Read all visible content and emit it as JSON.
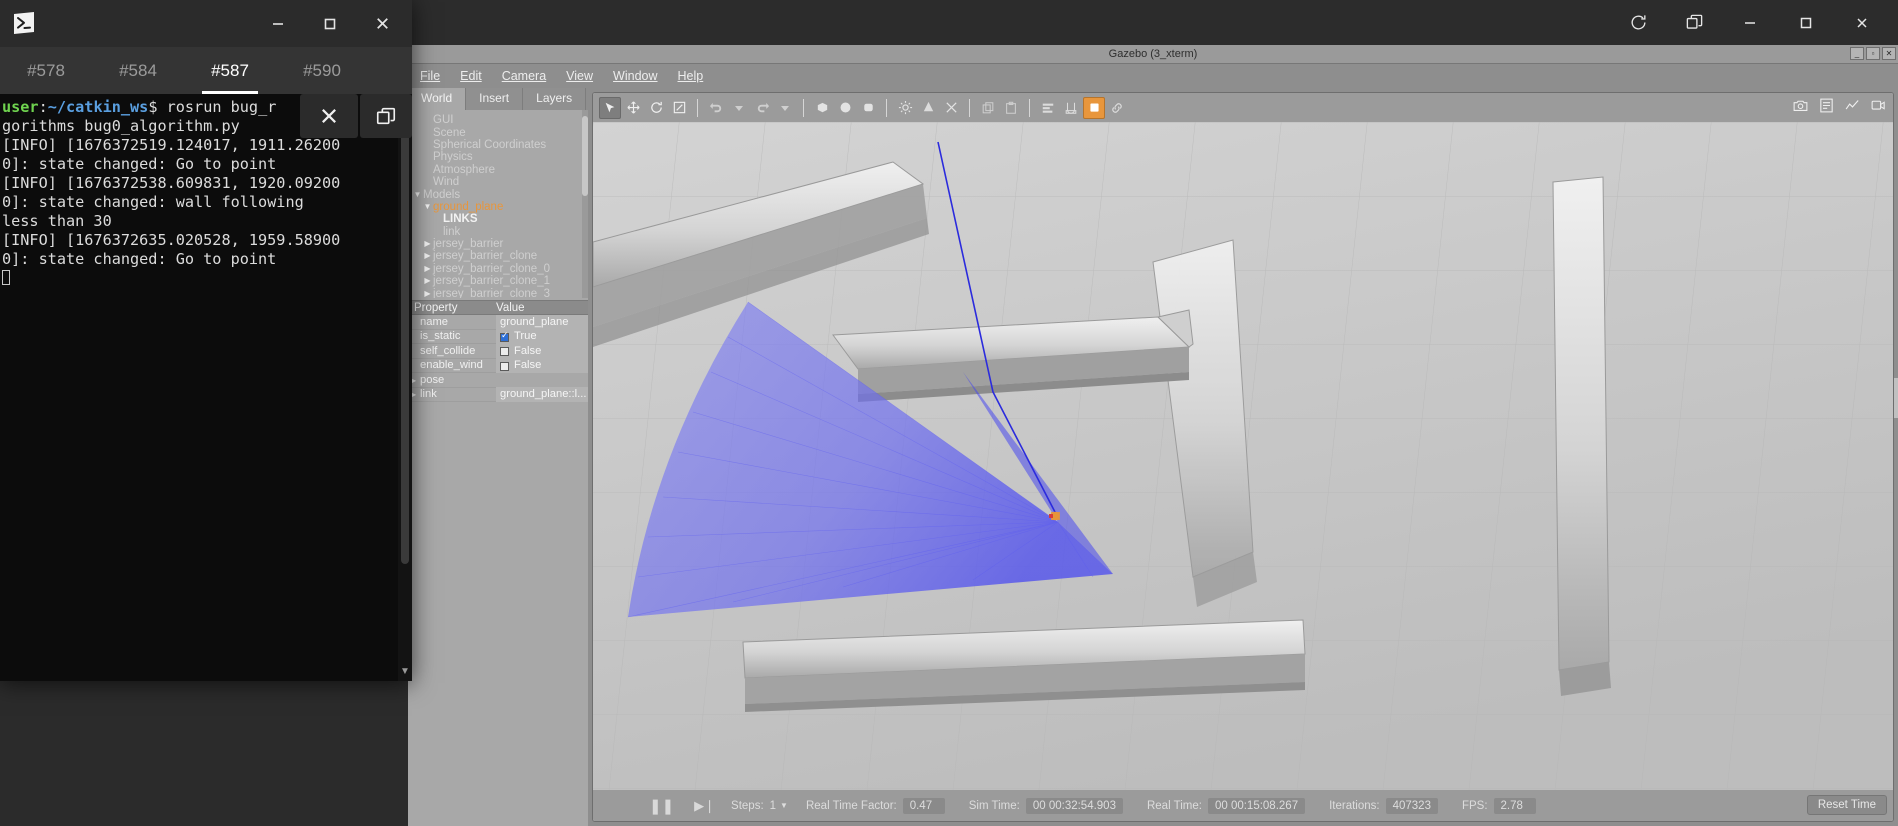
{
  "host_window": {
    "title_buttons": [
      {
        "name": "refresh",
        "glyph": "⟳"
      },
      {
        "name": "duplicate",
        "glyph": "❐"
      },
      {
        "name": "minimize",
        "glyph": "—"
      },
      {
        "name": "maximize",
        "glyph": "▢"
      },
      {
        "name": "close",
        "glyph": "✕"
      }
    ]
  },
  "gazebo": {
    "window_title": "Gazebo (3_xterm)",
    "window_buttons": [
      "_",
      "▫",
      "✕"
    ],
    "menu": [
      "File",
      "Edit",
      "Camera",
      "View",
      "Window",
      "Help"
    ],
    "panel_tabs": [
      "World",
      "Insert",
      "Layers"
    ],
    "tree": [
      {
        "label": "GUI",
        "indent": 1,
        "arrow": "",
        "style": "dim"
      },
      {
        "label": "Scene",
        "indent": 1,
        "arrow": "",
        "style": "dim"
      },
      {
        "label": "Spherical Coordinates",
        "indent": 1,
        "arrow": "",
        "style": "dim"
      },
      {
        "label": "Physics",
        "indent": 1,
        "arrow": "",
        "style": "dim"
      },
      {
        "label": "Atmosphere",
        "indent": 1,
        "arrow": "",
        "style": "dim"
      },
      {
        "label": "Wind",
        "indent": 1,
        "arrow": "",
        "style": "dim"
      },
      {
        "label": "Models",
        "indent": 0,
        "arrow": "▼",
        "style": "dim"
      },
      {
        "label": "ground_plane",
        "indent": 1,
        "arrow": "▼",
        "style": "sel"
      },
      {
        "label": "LINKS",
        "indent": 2,
        "arrow": "",
        "style": "bold"
      },
      {
        "label": "link",
        "indent": 2,
        "arrow": "",
        "style": "dim"
      },
      {
        "label": "jersey_barrier",
        "indent": 1,
        "arrow": "▶",
        "style": "dim"
      },
      {
        "label": "jersey_barrier_clone",
        "indent": 1,
        "arrow": "▶",
        "style": "dim"
      },
      {
        "label": "jersey_barrier_clone_0",
        "indent": 1,
        "arrow": "▶",
        "style": "dim"
      },
      {
        "label": "jersey_barrier_clone_1",
        "indent": 1,
        "arrow": "▶",
        "style": "dim"
      },
      {
        "label": "jersey_barrier_clone_3",
        "indent": 1,
        "arrow": "▶",
        "style": "dim"
      }
    ],
    "property_header": {
      "property": "Property",
      "value": "Value"
    },
    "properties": [
      {
        "key": "name",
        "value": "ground_plane",
        "type": "text",
        "arrow": ""
      },
      {
        "key": "is_static",
        "value": "True",
        "type": "check",
        "checked": true,
        "arrow": ""
      },
      {
        "key": "self_collide",
        "value": "False",
        "type": "check",
        "checked": false,
        "arrow": ""
      },
      {
        "key": "enable_wind",
        "value": "False",
        "type": "check",
        "checked": false,
        "arrow": ""
      },
      {
        "key": "pose",
        "value": "",
        "type": "group",
        "arrow": "▶"
      },
      {
        "key": "link",
        "value": "ground_plane::l...",
        "type": "text",
        "arrow": "▶"
      }
    ],
    "toolbar_icons": [
      "select-arrow-icon",
      "translate-icon",
      "rotate-icon",
      "scale-icon",
      "undo-icon",
      "undo-dropdown-icon",
      "redo-icon",
      "redo-dropdown-icon",
      "box-icon",
      "sphere-icon",
      "cylinder-icon",
      "point-light-icon",
      "spot-light-icon",
      "directional-light-icon",
      "copy-icon",
      "paste-icon",
      "align-icon",
      "snap-icon",
      "highlight-icon",
      "link-icon"
    ],
    "toolbar_right_icons": [
      "screenshot-icon",
      "log-icon",
      "plot-icon",
      "video-icon"
    ],
    "statusbar": {
      "pause_icon": "pause-icon",
      "step_icon": "step-icon",
      "steps_label": "Steps:",
      "steps_value": "1",
      "rtf_label": "Real Time Factor:",
      "rtf_value": "0.47",
      "sim_time_label": "Sim Time:",
      "sim_time_value": "00 00:32:54.903",
      "real_time_label": "Real Time:",
      "real_time_value": "00 00:15:08.267",
      "iterations_label": "Iterations:",
      "iterations_value": "407323",
      "fps_label": "FPS:",
      "fps_value": "2.78",
      "reset_label": "Reset Time"
    },
    "scene": {
      "laser_color": "#5b5bf0",
      "trajectory_color": "#2b2bdd",
      "robot_marker_color": "#e8963c"
    }
  },
  "terminal": {
    "logo": "terminal-prompt-icon",
    "window_buttons": [
      {
        "name": "minimize",
        "glyph": "—"
      },
      {
        "name": "maximize",
        "glyph": "▢"
      },
      {
        "name": "close",
        "glyph": "✕"
      }
    ],
    "tabs": [
      {
        "label": "#578",
        "active": false
      },
      {
        "label": "#584",
        "active": false
      },
      {
        "label": "#587",
        "active": true
      },
      {
        "label": "#590",
        "active": false
      }
    ],
    "prompt": {
      "user": "user",
      "separator": ":",
      "path": "~/catkin_ws",
      "dollar": "$"
    },
    "command": " rosrun bug_algorithms bug0_algorithm.py",
    "lines": [
      "gorithms bug0_algorithm.py",
      "[INFO] [1676372519.124017, 1911.26200",
      "0]: state changed: Go to point",
      "[INFO] [1676372538.609831, 1920.09200",
      "0]: state changed: wall following",
      "less than 30",
      "[INFO] [1676372635.020528, 1959.58900",
      "0]: state changed: Go to point"
    ],
    "first_line_command": " rosrun bug_r",
    "overlay_buttons": [
      {
        "name": "close",
        "glyph": "✕"
      },
      {
        "name": "restore",
        "glyph": "❐"
      }
    ]
  }
}
